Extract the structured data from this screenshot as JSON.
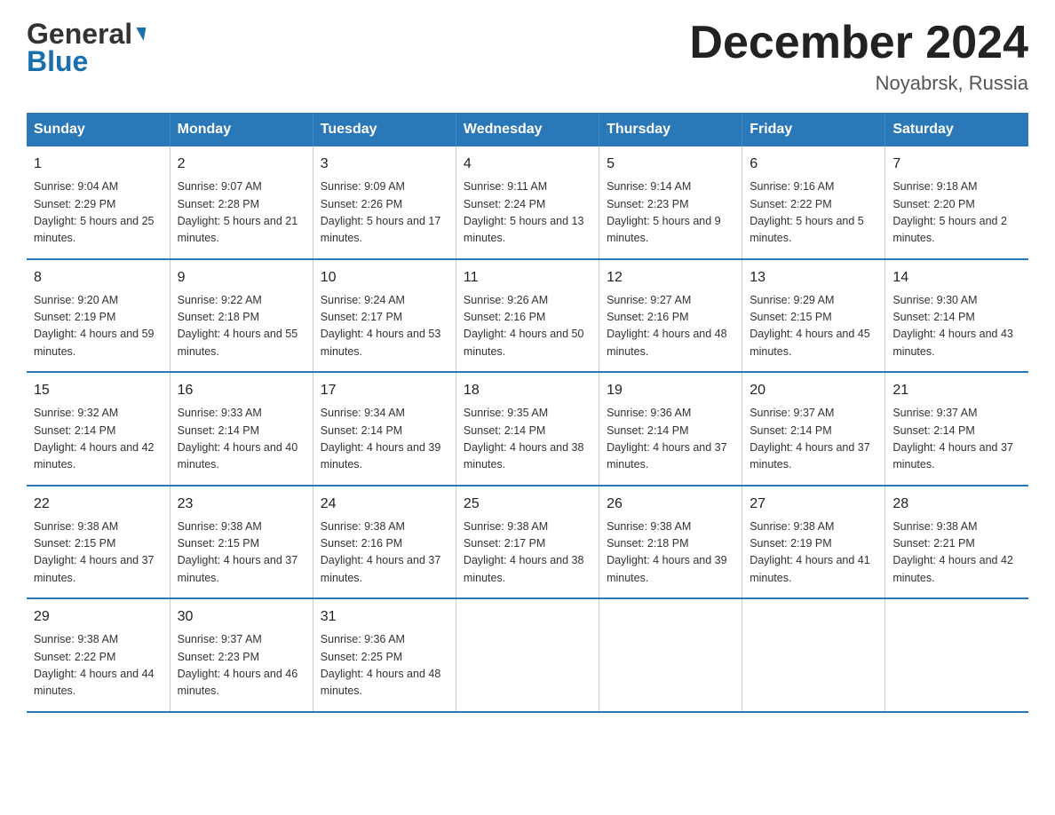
{
  "header": {
    "logo_line1": "General",
    "logo_line2": "Blue",
    "month_title": "December 2024",
    "location": "Noyabrsk, Russia"
  },
  "days_of_week": [
    "Sunday",
    "Monday",
    "Tuesday",
    "Wednesday",
    "Thursday",
    "Friday",
    "Saturday"
  ],
  "weeks": [
    [
      {
        "day": "1",
        "sunrise": "Sunrise: 9:04 AM",
        "sunset": "Sunset: 2:29 PM",
        "daylight": "Daylight: 5 hours and 25 minutes."
      },
      {
        "day": "2",
        "sunrise": "Sunrise: 9:07 AM",
        "sunset": "Sunset: 2:28 PM",
        "daylight": "Daylight: 5 hours and 21 minutes."
      },
      {
        "day": "3",
        "sunrise": "Sunrise: 9:09 AM",
        "sunset": "Sunset: 2:26 PM",
        "daylight": "Daylight: 5 hours and 17 minutes."
      },
      {
        "day": "4",
        "sunrise": "Sunrise: 9:11 AM",
        "sunset": "Sunset: 2:24 PM",
        "daylight": "Daylight: 5 hours and 13 minutes."
      },
      {
        "day": "5",
        "sunrise": "Sunrise: 9:14 AM",
        "sunset": "Sunset: 2:23 PM",
        "daylight": "Daylight: 5 hours and 9 minutes."
      },
      {
        "day": "6",
        "sunrise": "Sunrise: 9:16 AM",
        "sunset": "Sunset: 2:22 PM",
        "daylight": "Daylight: 5 hours and 5 minutes."
      },
      {
        "day": "7",
        "sunrise": "Sunrise: 9:18 AM",
        "sunset": "Sunset: 2:20 PM",
        "daylight": "Daylight: 5 hours and 2 minutes."
      }
    ],
    [
      {
        "day": "8",
        "sunrise": "Sunrise: 9:20 AM",
        "sunset": "Sunset: 2:19 PM",
        "daylight": "Daylight: 4 hours and 59 minutes."
      },
      {
        "day": "9",
        "sunrise": "Sunrise: 9:22 AM",
        "sunset": "Sunset: 2:18 PM",
        "daylight": "Daylight: 4 hours and 55 minutes."
      },
      {
        "day": "10",
        "sunrise": "Sunrise: 9:24 AM",
        "sunset": "Sunset: 2:17 PM",
        "daylight": "Daylight: 4 hours and 53 minutes."
      },
      {
        "day": "11",
        "sunrise": "Sunrise: 9:26 AM",
        "sunset": "Sunset: 2:16 PM",
        "daylight": "Daylight: 4 hours and 50 minutes."
      },
      {
        "day": "12",
        "sunrise": "Sunrise: 9:27 AM",
        "sunset": "Sunset: 2:16 PM",
        "daylight": "Daylight: 4 hours and 48 minutes."
      },
      {
        "day": "13",
        "sunrise": "Sunrise: 9:29 AM",
        "sunset": "Sunset: 2:15 PM",
        "daylight": "Daylight: 4 hours and 45 minutes."
      },
      {
        "day": "14",
        "sunrise": "Sunrise: 9:30 AM",
        "sunset": "Sunset: 2:14 PM",
        "daylight": "Daylight: 4 hours and 43 minutes."
      }
    ],
    [
      {
        "day": "15",
        "sunrise": "Sunrise: 9:32 AM",
        "sunset": "Sunset: 2:14 PM",
        "daylight": "Daylight: 4 hours and 42 minutes."
      },
      {
        "day": "16",
        "sunrise": "Sunrise: 9:33 AM",
        "sunset": "Sunset: 2:14 PM",
        "daylight": "Daylight: 4 hours and 40 minutes."
      },
      {
        "day": "17",
        "sunrise": "Sunrise: 9:34 AM",
        "sunset": "Sunset: 2:14 PM",
        "daylight": "Daylight: 4 hours and 39 minutes."
      },
      {
        "day": "18",
        "sunrise": "Sunrise: 9:35 AM",
        "sunset": "Sunset: 2:14 PM",
        "daylight": "Daylight: 4 hours and 38 minutes."
      },
      {
        "day": "19",
        "sunrise": "Sunrise: 9:36 AM",
        "sunset": "Sunset: 2:14 PM",
        "daylight": "Daylight: 4 hours and 37 minutes."
      },
      {
        "day": "20",
        "sunrise": "Sunrise: 9:37 AM",
        "sunset": "Sunset: 2:14 PM",
        "daylight": "Daylight: 4 hours and 37 minutes."
      },
      {
        "day": "21",
        "sunrise": "Sunrise: 9:37 AM",
        "sunset": "Sunset: 2:14 PM",
        "daylight": "Daylight: 4 hours and 37 minutes."
      }
    ],
    [
      {
        "day": "22",
        "sunrise": "Sunrise: 9:38 AM",
        "sunset": "Sunset: 2:15 PM",
        "daylight": "Daylight: 4 hours and 37 minutes."
      },
      {
        "day": "23",
        "sunrise": "Sunrise: 9:38 AM",
        "sunset": "Sunset: 2:15 PM",
        "daylight": "Daylight: 4 hours and 37 minutes."
      },
      {
        "day": "24",
        "sunrise": "Sunrise: 9:38 AM",
        "sunset": "Sunset: 2:16 PM",
        "daylight": "Daylight: 4 hours and 37 minutes."
      },
      {
        "day": "25",
        "sunrise": "Sunrise: 9:38 AM",
        "sunset": "Sunset: 2:17 PM",
        "daylight": "Daylight: 4 hours and 38 minutes."
      },
      {
        "day": "26",
        "sunrise": "Sunrise: 9:38 AM",
        "sunset": "Sunset: 2:18 PM",
        "daylight": "Daylight: 4 hours and 39 minutes."
      },
      {
        "day": "27",
        "sunrise": "Sunrise: 9:38 AM",
        "sunset": "Sunset: 2:19 PM",
        "daylight": "Daylight: 4 hours and 41 minutes."
      },
      {
        "day": "28",
        "sunrise": "Sunrise: 9:38 AM",
        "sunset": "Sunset: 2:21 PM",
        "daylight": "Daylight: 4 hours and 42 minutes."
      }
    ],
    [
      {
        "day": "29",
        "sunrise": "Sunrise: 9:38 AM",
        "sunset": "Sunset: 2:22 PM",
        "daylight": "Daylight: 4 hours and 44 minutes."
      },
      {
        "day": "30",
        "sunrise": "Sunrise: 9:37 AM",
        "sunset": "Sunset: 2:23 PM",
        "daylight": "Daylight: 4 hours and 46 minutes."
      },
      {
        "day": "31",
        "sunrise": "Sunrise: 9:36 AM",
        "sunset": "Sunset: 2:25 PM",
        "daylight": "Daylight: 4 hours and 48 minutes."
      },
      null,
      null,
      null,
      null
    ]
  ]
}
